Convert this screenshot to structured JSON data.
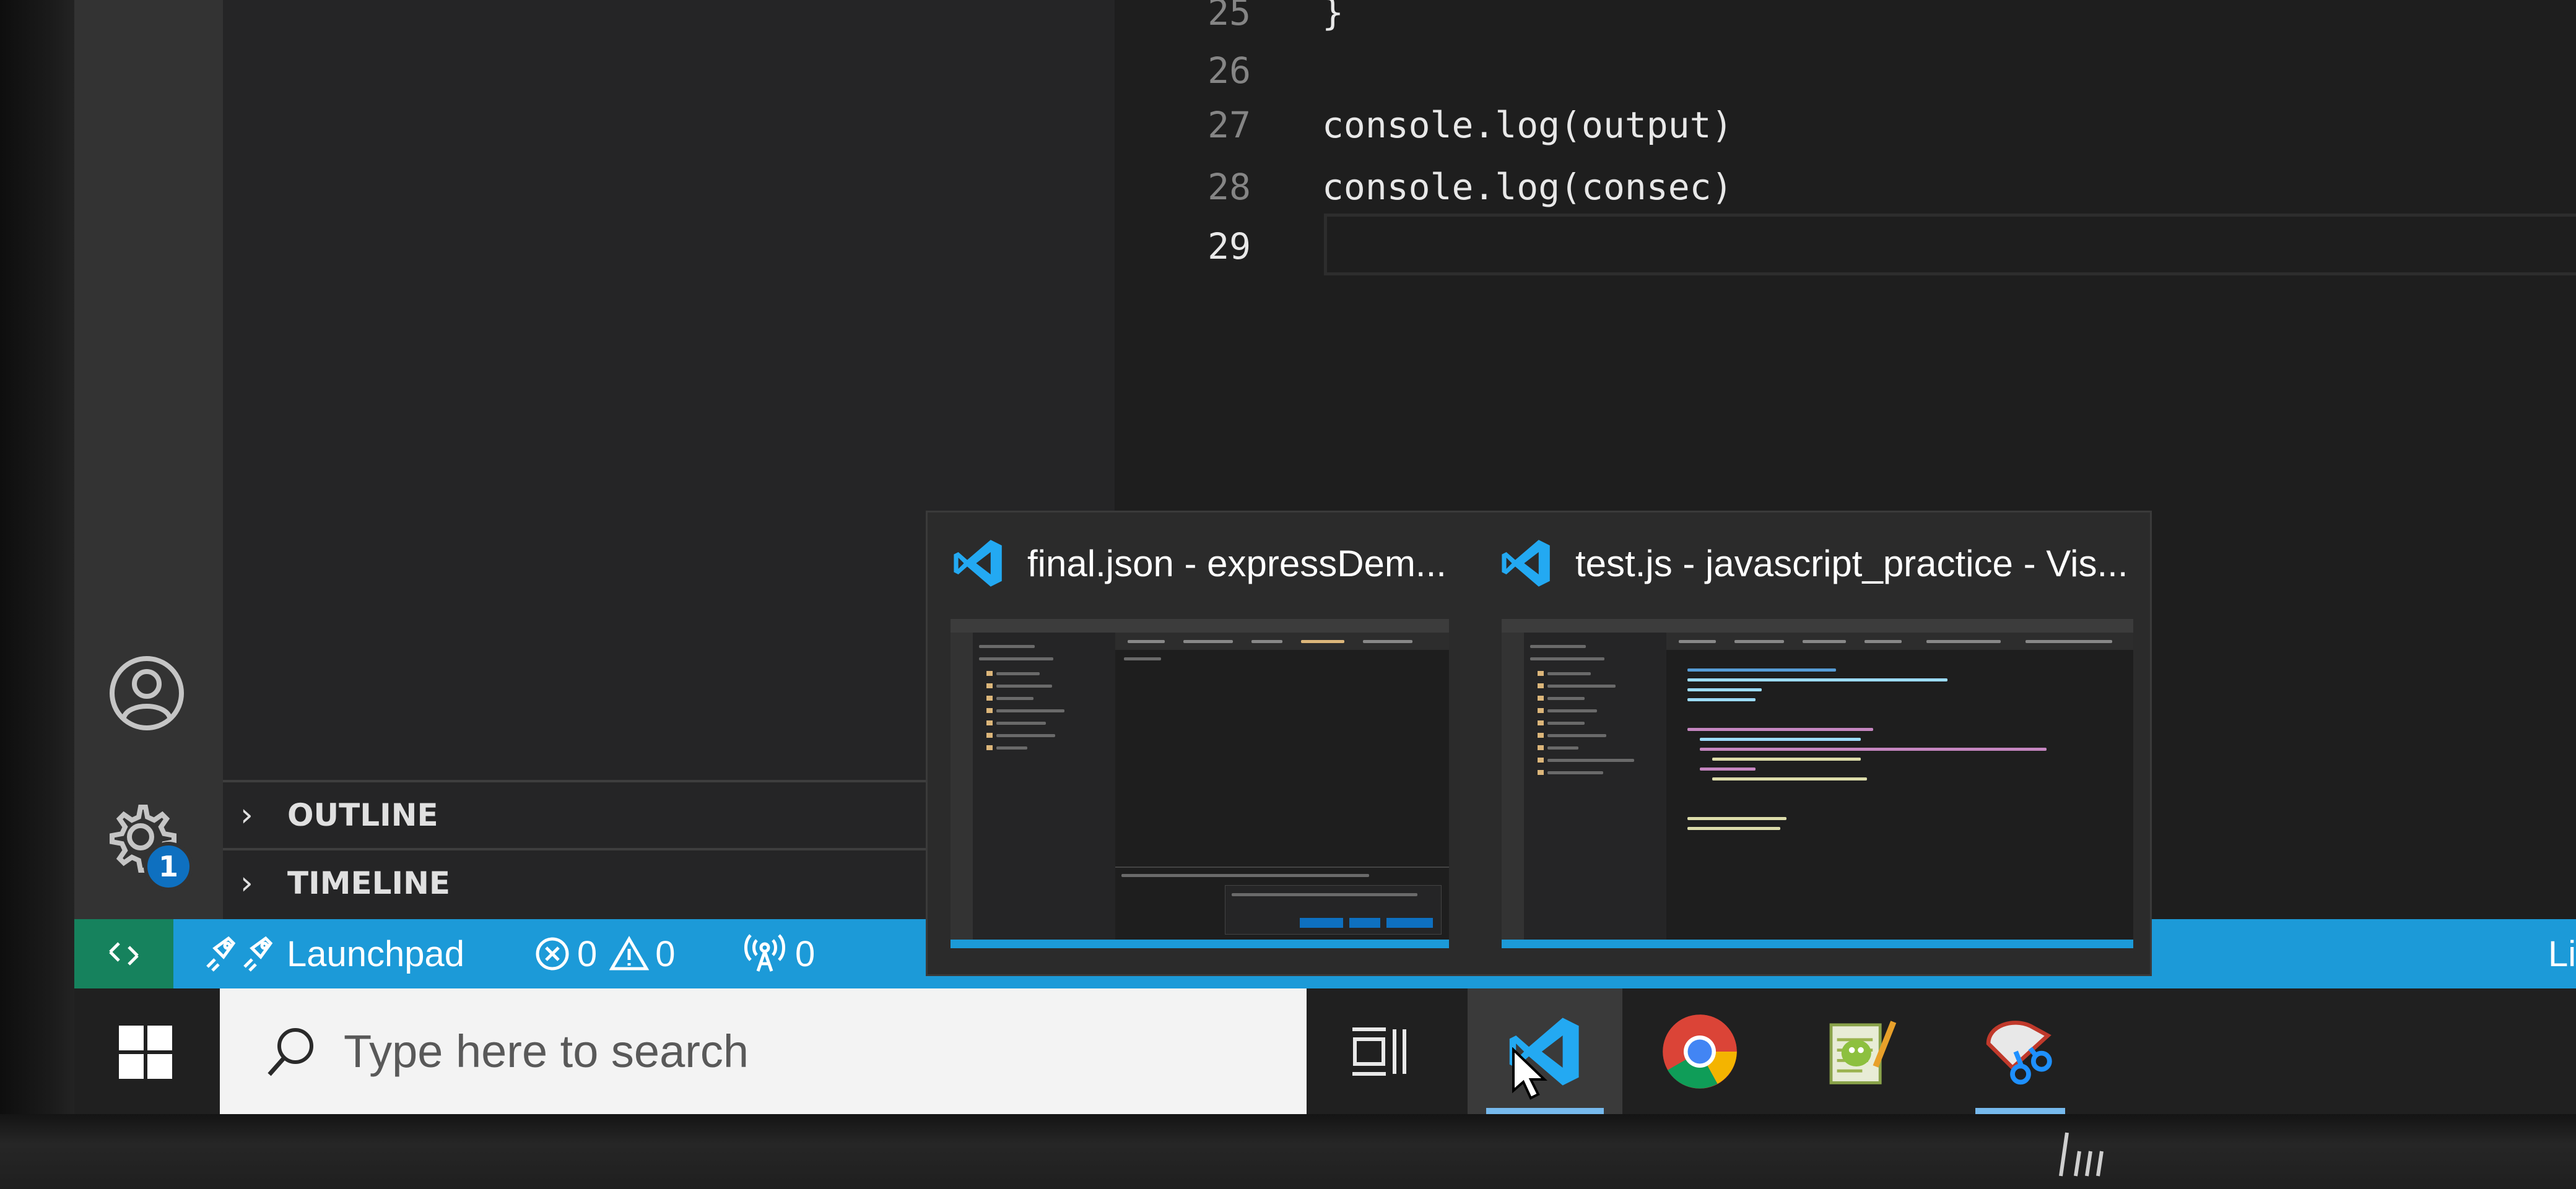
{
  "editor": {
    "lines": [
      {
        "number": "25",
        "code": "}"
      },
      {
        "number": "26",
        "code": ""
      },
      {
        "number": "27",
        "code": "console.log(output)"
      },
      {
        "number": "28",
        "code": "console.log(consec)"
      },
      {
        "number": "29",
        "code": ""
      }
    ]
  },
  "sidebar": {
    "sections": [
      {
        "label": "OUTLINE"
      },
      {
        "label": "TIMELINE"
      }
    ]
  },
  "activity_bar": {
    "settings_badge": "1"
  },
  "status_bar": {
    "launchpad_label": "Launchpad",
    "errors": "0",
    "warnings": "0",
    "ports": "0",
    "right_text": "Li"
  },
  "taskbar": {
    "search_placeholder": "Type here to search",
    "apps": [
      "task-view",
      "visual-studio-code",
      "google-chrome",
      "notepad++",
      "snipping-tool"
    ]
  },
  "thumbnails": [
    {
      "title": "final.json - expressDem..."
    },
    {
      "title": "test.js - javascript_practice - Vis..."
    }
  ],
  "colors": {
    "status_bar": "#1c9ad8",
    "remote_indicator": "#16825d",
    "vscode_blue": "#23a9f2",
    "taskbar": "#202020"
  }
}
